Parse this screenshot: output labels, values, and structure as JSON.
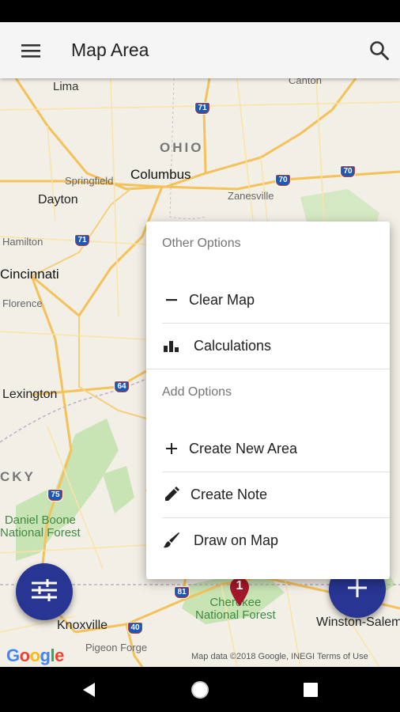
{
  "app_bar": {
    "title": "Map Area",
    "menu_icon": "hamburger-menu-icon",
    "search_icon": "search-icon",
    "background": "#f5f5f5"
  },
  "map": {
    "labels": {
      "lima": "Lima",
      "canton": "Canton",
      "ohio": "OHIO",
      "springfield": "Springfield",
      "columbus": "Columbus",
      "dayton": "Dayton",
      "zanesville": "Zanesville",
      "hamilton": "Hamilton",
      "cincinnati": "Cincinnati",
      "florence": "Florence",
      "lexington": "Lexington",
      "kentucky": "CKY",
      "daniel_boone": "Daniel Boone\nNational Forest",
      "knoxville": "Knoxville",
      "pigeon_forge": "Pigeon Forge",
      "cherokee": "Cherokee\nNational Forest",
      "winston_salem": "Winston-Salem"
    },
    "shields": {
      "i71_top": "71",
      "i70_east": "70",
      "i70_center": "70",
      "i71_mid": "71",
      "i64": "64",
      "i75": "75",
      "i81": "81",
      "i40": "40"
    },
    "marker_number": "1",
    "logo": "Google",
    "attribution": "Map data ©2018 Google, INEGI   Terms of Use"
  },
  "popup": {
    "other_header": "Other Options",
    "add_header": "Add Options",
    "items": [
      {
        "label": "Clear Map",
        "icon": "minus-icon"
      },
      {
        "label": "Calculations",
        "icon": "bar-chart-icon"
      },
      {
        "label": "Create New Area",
        "icon": "plus-icon"
      },
      {
        "label": "Create Note",
        "icon": "pencil-icon"
      },
      {
        "label": "Draw on Map",
        "icon": "brush-icon"
      }
    ]
  },
  "fabs": {
    "filter_icon": "tune-sliders-icon",
    "add_icon": "plus-icon",
    "color": "#283593"
  },
  "nav": {
    "back_icon": "back-triangle-icon",
    "home_icon": "home-circle-icon",
    "recents_icon": "recents-square-icon"
  }
}
